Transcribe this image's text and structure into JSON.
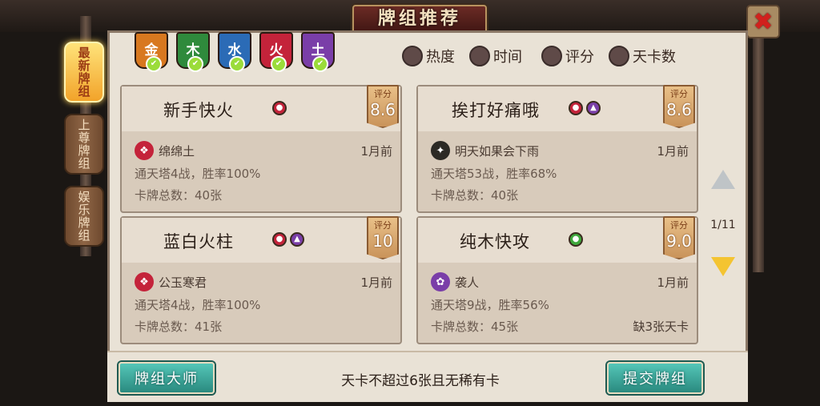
{
  "header": {
    "title": "牌组推荐",
    "close_icon": "close-icon"
  },
  "tabs": [
    {
      "label": "最新牌组",
      "active": true
    },
    {
      "label": "上尊牌组",
      "active": false
    },
    {
      "label": "娱乐牌组",
      "active": false
    }
  ],
  "elements": [
    {
      "label": "金",
      "color": "#d8781f",
      "checked": true
    },
    {
      "label": "木",
      "color": "#2f8a3c",
      "checked": true
    },
    {
      "label": "水",
      "color": "#2b6bb6",
      "checked": true
    },
    {
      "label": "火",
      "color": "#c4233a",
      "checked": true
    },
    {
      "label": "土",
      "color": "#7a3ea8",
      "checked": true
    }
  ],
  "sort": [
    {
      "label": "热度"
    },
    {
      "label": "时间"
    },
    {
      "label": "评分"
    },
    {
      "label": "天卡数"
    }
  ],
  "decks": [
    {
      "name": "新手快火",
      "score_label": "评分",
      "score": "8.6",
      "author": "绵绵土",
      "time": "1月前",
      "stat1": "通天塔4战，胜率100%",
      "stat2": "卡牌总数：40张",
      "missing": "",
      "elements": [
        "fire"
      ]
    },
    {
      "name": "挨打好痛哦",
      "score_label": "评分",
      "score": "8.6",
      "author": "明天如果会下雨",
      "time": "1月前",
      "stat1": "通天塔53战，胜率68%",
      "stat2": "卡牌总数：40张",
      "missing": "",
      "elements": [
        "fire",
        "earth"
      ]
    },
    {
      "name": "蓝白火柱",
      "score_label": "评分",
      "score": "10",
      "author": "公玉寒君",
      "time": "1月前",
      "stat1": "通天塔4战，胜率100%",
      "stat2": "卡牌总数：41张",
      "missing": "",
      "elements": [
        "fire",
        "earth"
      ]
    },
    {
      "name": "纯木快攻",
      "score_label": "评分",
      "score": "9.0",
      "author": "袭人",
      "time": "1月前",
      "stat1": "通天塔9战，胜率56%",
      "stat2": "卡牌总数：45张",
      "missing": "缺3张天卡",
      "elements": [
        "wood"
      ]
    }
  ],
  "pagination": {
    "indicator": "1/11"
  },
  "footer": {
    "master_button": "牌组大师",
    "rule": "天卡不超过6张且无稀有卡",
    "submit_button": "提交牌组"
  }
}
